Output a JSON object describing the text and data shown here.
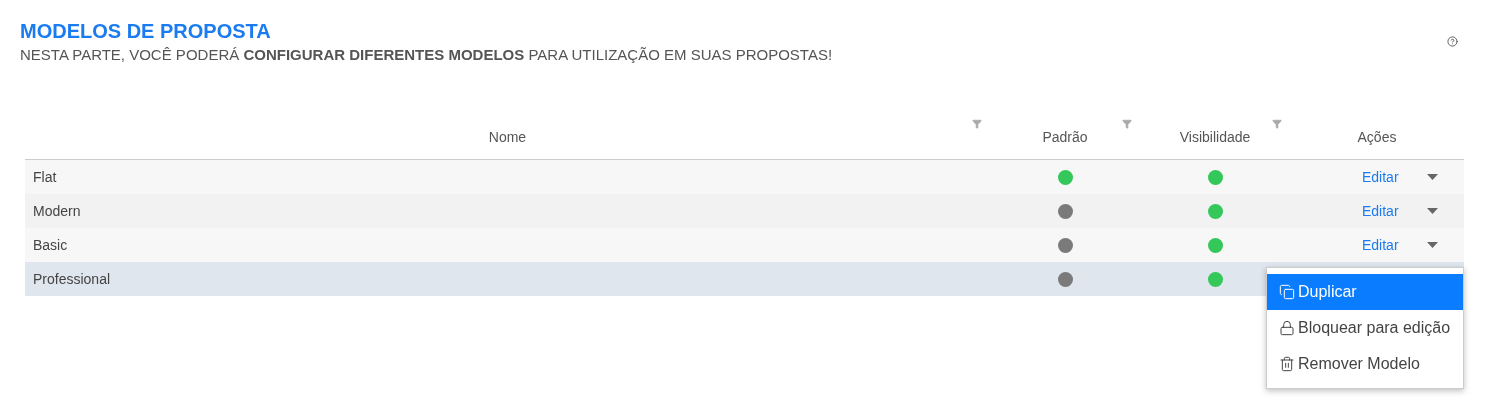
{
  "header": {
    "title": "MODELOS DE PROPOSTA",
    "subtitle": "NESTA PARTE, VOCÊ PODERÁ **CONFIGURAR DIFERENTES MODELOS** PARA UTILIZAÇÃO EM SUAS PROPOSTAS!"
  },
  "table": {
    "columns": [
      {
        "label": "Nome",
        "filter": true
      },
      {
        "label": "Padrão",
        "filter": true
      },
      {
        "label": "Visibilidade",
        "filter": true
      },
      {
        "label": "Ações",
        "filter": false
      }
    ],
    "rows": [
      {
        "name": "Flat",
        "default": true,
        "visible": true,
        "action": "Editar",
        "selected": false
      },
      {
        "name": "Modern",
        "default": false,
        "visible": true,
        "action": "Editar",
        "selected": false
      },
      {
        "name": "Basic",
        "default": false,
        "visible": true,
        "action": "Editar",
        "selected": false
      },
      {
        "name": "Professional",
        "default": false,
        "visible": true,
        "selected": true
      }
    ]
  },
  "menu": {
    "items": [
      {
        "label": "Duplicar",
        "kind": "copy",
        "selected": true
      },
      {
        "label": "Bloquear para edição",
        "kind": "lock",
        "selected": false
      },
      {
        "label": "Remover Modelo",
        "kind": "trash",
        "selected": false
      }
    ]
  }
}
